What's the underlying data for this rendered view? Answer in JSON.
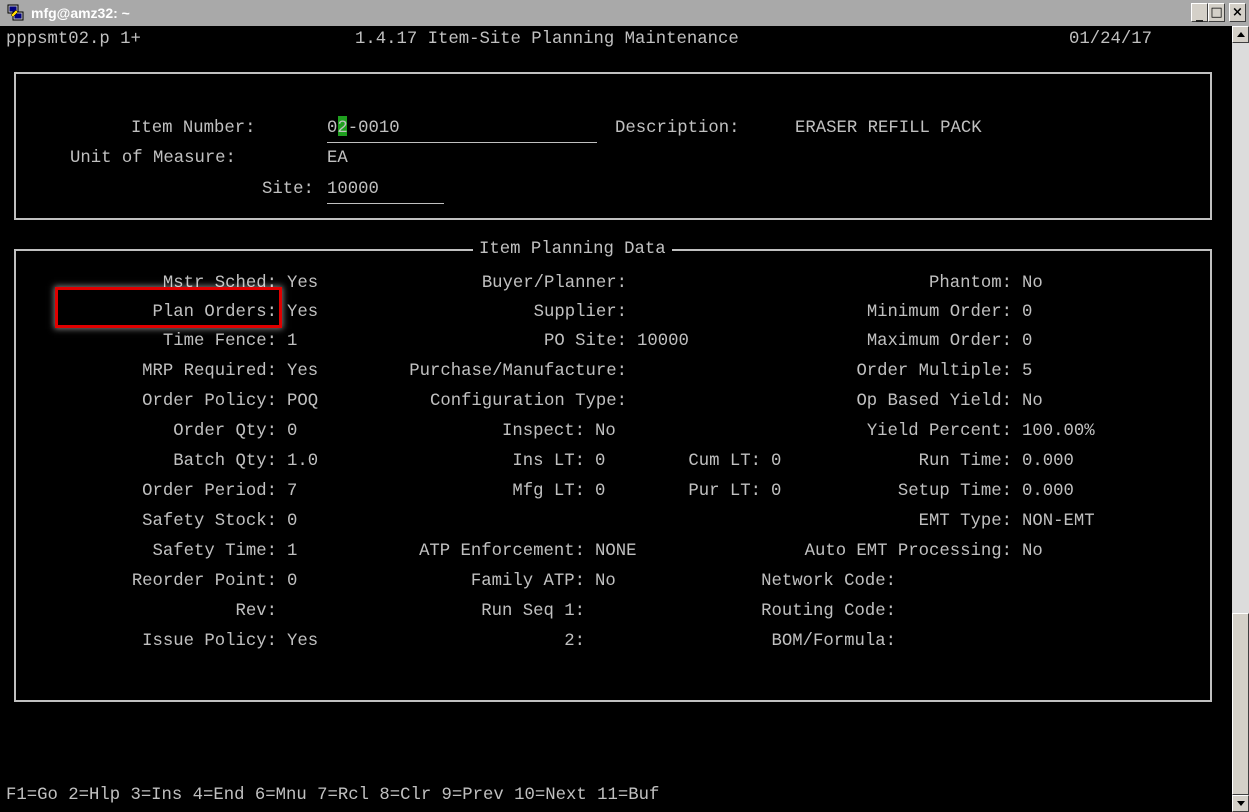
{
  "window": {
    "title": "mfg@amz32: ~",
    "controls": {
      "minimize": "_",
      "maximize": "□",
      "close": "×"
    },
    "icons": [
      "putty-terminal-icon",
      "minimize-icon",
      "maximize-icon",
      "close-icon",
      "scroll-up-arrow-icon",
      "scroll-down-arrow-icon"
    ]
  },
  "header": {
    "program": "pppsmt02.p 1+",
    "screen_title": "1.4.17 Item-Site Planning Maintenance",
    "date": "01/24/17"
  },
  "top_section": {
    "item_number_label": "Item Number:",
    "item_number_value": "02-0010",
    "description_label": "Description:",
    "description_value": "ERASER REFILL PACK",
    "uom_label": "Unit of Measure:",
    "uom_value": "EA",
    "site_label": "Site:",
    "site_value": "10000"
  },
  "planning": {
    "legend": "Item Planning Data",
    "mstr_sched": {
      "label": "Mstr Sched:",
      "value": "Yes"
    },
    "plan_orders": {
      "label": "Plan Orders:",
      "value": "Yes"
    },
    "time_fence": {
      "label": "Time Fence:",
      "value": "1"
    },
    "mrp_required": {
      "label": "MRP Required:",
      "value": "Yes"
    },
    "order_policy": {
      "label": "Order Policy:",
      "value": "POQ"
    },
    "order_qty": {
      "label": "Order Qty:",
      "value": "0"
    },
    "batch_qty": {
      "label": "Batch Qty:",
      "value": "1.0"
    },
    "order_period": {
      "label": "Order Period:",
      "value": "7"
    },
    "safety_stock": {
      "label": "Safety Stock:",
      "value": "0"
    },
    "safety_time": {
      "label": "Safety Time:",
      "value": "1"
    },
    "reorder_point": {
      "label": "Reorder Point:",
      "value": "0"
    },
    "rev": {
      "label": "Rev:",
      "value": ""
    },
    "issue_policy": {
      "label": "Issue Policy:",
      "value": "Yes"
    },
    "buyer_planner": {
      "label": "Buyer/Planner:",
      "value": ""
    },
    "supplier": {
      "label": "Supplier:",
      "value": ""
    },
    "po_site": {
      "label": "PO Site:",
      "value": "10000"
    },
    "purchase_manufacture": {
      "label": "Purchase/Manufacture:",
      "value": ""
    },
    "configuration_type": {
      "label": "Configuration Type:",
      "value": ""
    },
    "inspect": {
      "label": "Inspect:",
      "value": "No"
    },
    "ins_lt": {
      "label": "Ins LT:",
      "value": "0"
    },
    "mfg_lt": {
      "label": "Mfg LT:",
      "value": "0"
    },
    "atp_enforcement": {
      "label": "ATP Enforcement:",
      "value": "NONE"
    },
    "family_atp": {
      "label": "Family ATP:",
      "value": "No"
    },
    "run_seq_1": {
      "label": "Run Seq 1:",
      "value": ""
    },
    "run_seq_2": {
      "label": "2:",
      "value": ""
    },
    "cum_lt": {
      "label": "Cum LT:",
      "value": "0"
    },
    "pur_lt": {
      "label": "Pur LT:",
      "value": "0"
    },
    "phantom": {
      "label": "Phantom:",
      "value": "No"
    },
    "minimum_order": {
      "label": "Minimum Order:",
      "value": "0"
    },
    "maximum_order": {
      "label": "Maximum Order:",
      "value": "0"
    },
    "order_multiple": {
      "label": "Order Multiple:",
      "value": "5"
    },
    "op_based_yield": {
      "label": "Op Based Yield:",
      "value": "No"
    },
    "yield_percent": {
      "label": "Yield Percent:",
      "value": "100.00%"
    },
    "run_time": {
      "label": "Run Time:",
      "value": "0.000"
    },
    "setup_time": {
      "label": "Setup Time:",
      "value": "0.000"
    },
    "emt_type": {
      "label": "EMT Type:",
      "value": "NON-EMT"
    },
    "auto_emt": {
      "label": "Auto EMT Processing:",
      "value": "No"
    },
    "network_code": {
      "label": "Network Code:",
      "value": ""
    },
    "routing_code": {
      "label": "Routing Code:",
      "value": ""
    },
    "bom_formula": {
      "label": "BOM/Formula:",
      "value": ""
    }
  },
  "footer": {
    "function_keys": "F1=Go 2=Hlp 3=Ins 4=End 6=Mnu 7=Rcl 8=Clr 9=Prev 10=Next 11=Buf"
  }
}
